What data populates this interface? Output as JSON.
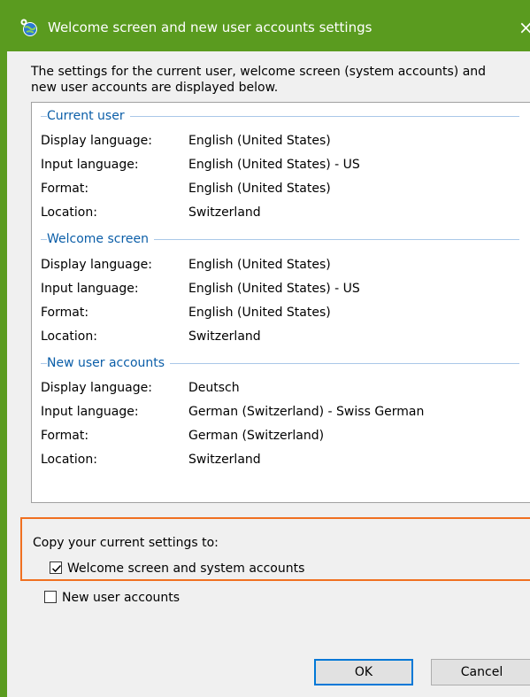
{
  "window": {
    "title": "Welcome screen and new user accounts settings",
    "close_glyph": "×"
  },
  "intro_text": "The settings for the current user, welcome screen (system accounts) and new user accounts are displayed below.",
  "groups": [
    {
      "header": "Current user",
      "rows": [
        {
          "label": "Display language:",
          "value": "English (United States)"
        },
        {
          "label": "Input language:",
          "value": "English (United States) - US"
        },
        {
          "label": "Format:",
          "value": "English (United States)"
        },
        {
          "label": "Location:",
          "value": "Switzerland"
        }
      ]
    },
    {
      "header": "Welcome screen",
      "rows": [
        {
          "label": "Display language:",
          "value": "English (United States)"
        },
        {
          "label": "Input language:",
          "value": "English (United States) - US"
        },
        {
          "label": "Format:",
          "value": "English (United States)"
        },
        {
          "label": "Location:",
          "value": "Switzerland"
        }
      ]
    },
    {
      "header": "New user accounts",
      "rows": [
        {
          "label": "Display language:",
          "value": "Deutsch"
        },
        {
          "label": "Input language:",
          "value": "German (Switzerland) - Swiss German"
        },
        {
          "label": "Format:",
          "value": "German (Switzerland)"
        },
        {
          "label": "Location:",
          "value": "Switzerland"
        }
      ]
    }
  ],
  "copy": {
    "label": "Copy your current settings to:",
    "options": [
      {
        "label": "Welcome screen and system accounts",
        "checked": true
      },
      {
        "label": "New user accounts",
        "checked": false
      }
    ]
  },
  "buttons": {
    "ok": "OK",
    "cancel": "Cancel"
  },
  "colors": {
    "titlebar": "#5a9b1f",
    "group_header": "#0b5ea8",
    "highlight_border": "#f07020",
    "default_button_border": "#0078d7"
  },
  "icons": {
    "title": "language-settings-icon",
    "close": "close-icon",
    "check": "checkmark-icon"
  }
}
